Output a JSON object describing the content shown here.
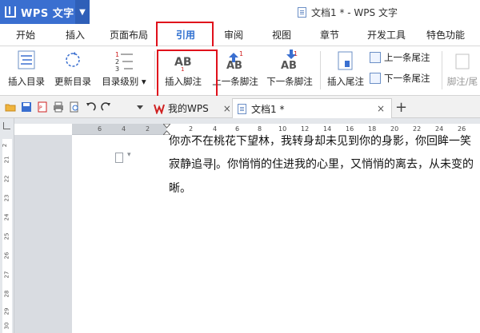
{
  "app": {
    "name": "WPS 文字",
    "menu_arrow": "▼"
  },
  "window_title": "文档1 * - WPS 文字",
  "ribbon_tabs": [
    "开始",
    "插入",
    "页面布局",
    "引用",
    "审阅",
    "视图",
    "章节",
    "开发工具",
    "特色功能"
  ],
  "active_tab": "引用",
  "ribbon": {
    "insert_toc": "插入目录",
    "update_toc": "更新目录",
    "toc_level": "目录级别",
    "insert_footnote": "插入脚注",
    "prev_footnote": "上一条脚注",
    "next_footnote": "下一条脚注",
    "insert_endnote": "插入尾注",
    "prev_endnote": "上一条尾注",
    "next_endnote": "下一条尾注",
    "footnote_endnote_sep": "脚注/尾",
    "ab": "AB",
    "one": "1",
    "toc_nums": [
      "1",
      "2",
      "3"
    ]
  },
  "doc_tabs": {
    "my_wps": "我的WPS",
    "doc1": "文档1 *",
    "close": "×",
    "add": "+"
  },
  "ruler_h": [
    "6",
    "4",
    "2",
    "2",
    "4",
    "6",
    "8",
    "10",
    "12",
    "14",
    "16",
    "18",
    "20",
    "22",
    "24",
    "26"
  ],
  "ruler_v": [
    "2",
    "21",
    "22",
    "23",
    "24",
    "25",
    "26",
    "27",
    "28",
    "29",
    "30"
  ],
  "document": {
    "line1": "你亦不在桃花下望林，我转身却未见到你的身影，你回眸一笑",
    "line2_before": "寂静追寻",
    "line2_after": "。你悄悄的住进我的心里，又悄悄的离去，从未变的",
    "line3": "晰。"
  }
}
